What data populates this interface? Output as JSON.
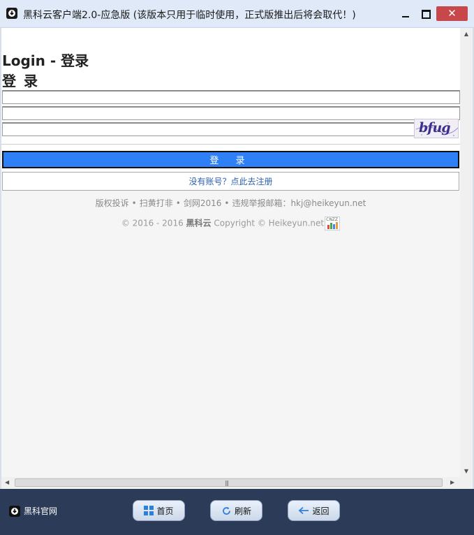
{
  "window": {
    "title": "黑科云客户端2.0-应急版 (该版本只用于临时使用，正式版推出后将会取代！)",
    "minimize": "–",
    "maximize": "□",
    "close": "✕"
  },
  "page": {
    "heading": "Login - 登录",
    "subheading": "登 录",
    "username": {
      "value": "",
      "placeholder": ""
    },
    "password": {
      "value": "",
      "placeholder": ""
    },
    "captcha_input": {
      "value": "",
      "placeholder": ""
    },
    "captcha_text": "bfug",
    "login_button": "登 录",
    "register_link": "没有账号？点此去注册",
    "footer_links": [
      "版权投诉",
      "扫黄打非",
      "剑网2016",
      "违规举报邮箱：hkj@heikeyun.net"
    ],
    "footer_separator": "•",
    "copyright_prefix": "© 2016 - 2016",
    "copyright_brand": "黑科云",
    "copyright_suffix": "Copyright © Heikeyun.net",
    "cnzz_label": "CNZZ"
  },
  "scrollbar": {
    "up_arrow": "▲",
    "down_arrow": "▼",
    "left_arrow": "◀",
    "right_arrow": "▶",
    "grip": "|||"
  },
  "bottombar": {
    "brand": "黑科官网",
    "home": "首页",
    "refresh": "刷新",
    "back": "返回"
  },
  "colors": {
    "login_button": "#2f80f6",
    "bottombar": "#2c3b57",
    "close_button": "#c8474a",
    "link": "#2d5fb0"
  }
}
